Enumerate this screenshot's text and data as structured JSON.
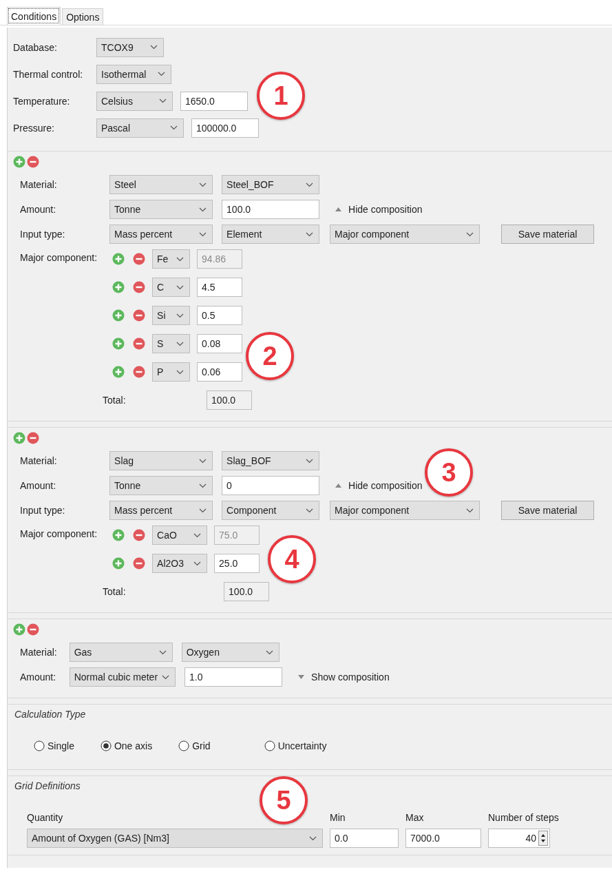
{
  "tabs": [
    {
      "label": "Conditions",
      "selected": true
    },
    {
      "label": "Options",
      "selected": false
    }
  ],
  "conditions": {
    "rows": [
      {
        "label": "Database:",
        "combo": "TCOX9"
      },
      {
        "label": "Thermal control:",
        "combo": "Isothermal"
      },
      {
        "label": "Temperature:",
        "combo": "Celsius",
        "value": "1650.0"
      },
      {
        "label": "Pressure:",
        "combo": "Pascal",
        "value": "100000.0"
      }
    ],
    "callout": "1"
  },
  "materials": [
    {
      "material": {
        "label": "Material:",
        "type": "Steel",
        "preset": "Steel_BOF"
      },
      "amount": {
        "label": "Amount:",
        "unit": "Tonne",
        "value": "100.0"
      },
      "toggle": {
        "label": "Hide composition",
        "expanded": true
      },
      "input_type": {
        "label": "Input type:",
        "basis": "Mass percent",
        "entity": "Element",
        "component": "Major component",
        "save": "Save material"
      },
      "components": {
        "label": "Major component:",
        "items": [
          {
            "name": "Fe",
            "value": "94.86",
            "disabled": true
          },
          {
            "name": "C",
            "value": "4.5",
            "disabled": false
          },
          {
            "name": "Si",
            "value": "0.5",
            "disabled": false
          },
          {
            "name": "S",
            "value": "0.08",
            "disabled": false
          },
          {
            "name": "P",
            "value": "0.06",
            "disabled": false
          }
        ],
        "total_label": "Total:",
        "total": "100.0",
        "callout": "2"
      }
    },
    {
      "material": {
        "label": "Material:",
        "type": "Slag",
        "preset": "Slag_BOF"
      },
      "amount": {
        "label": "Amount:",
        "unit": "Tonne",
        "value": "0",
        "callout": "3"
      },
      "toggle": {
        "label": "Hide composition",
        "expanded": true
      },
      "input_type": {
        "label": "Input type:",
        "basis": "Mass percent",
        "entity": "Component",
        "component": "Major component",
        "save": "Save material"
      },
      "components": {
        "label": "Major component:",
        "items": [
          {
            "name": "CaO",
            "value": "75.0",
            "disabled": true
          },
          {
            "name": "Al2O3",
            "value": "25.0",
            "disabled": false
          }
        ],
        "total_label": "Total:",
        "total": "100.0",
        "callout": "4"
      }
    },
    {
      "material": {
        "label": "Material:",
        "type": "Gas",
        "preset": "Oxygen"
      },
      "amount": {
        "label": "Amount:",
        "unit": "Normal cubic meter",
        "value": "1.0"
      },
      "toggle": {
        "label": "Show composition",
        "expanded": false
      }
    }
  ],
  "calculation_type": {
    "title": "Calculation Type",
    "options": [
      {
        "label": "Single",
        "selected": false
      },
      {
        "label": "One axis",
        "selected": true
      },
      {
        "label": "Grid",
        "selected": false
      },
      {
        "label": "Uncertainty",
        "selected": false
      }
    ]
  },
  "grid_definitions": {
    "title": "Grid Definitions",
    "callout": "5",
    "headers": [
      "Quantity",
      "Min",
      "Max",
      "Number of steps"
    ],
    "quantity": "Amount of Oxygen (GAS) [Nm3]",
    "min": "0.0",
    "max": "7000.0",
    "steps": "40"
  }
}
